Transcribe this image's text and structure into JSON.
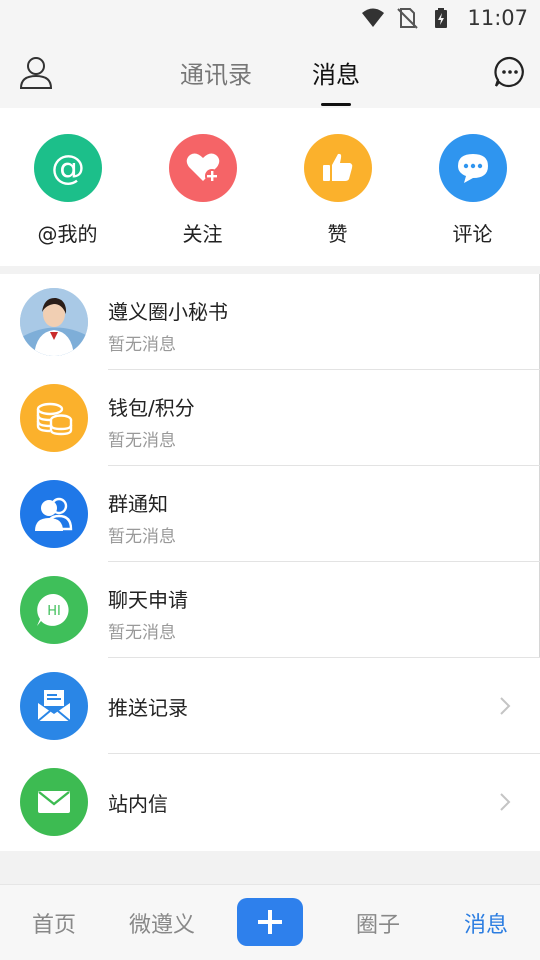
{
  "status_bar": {
    "time": "11:07"
  },
  "header": {
    "tabs": [
      {
        "label": "通讯录",
        "active": false
      },
      {
        "label": "消息",
        "active": true
      }
    ]
  },
  "quick_actions": [
    {
      "label": "@我的",
      "icon": "at-icon",
      "color": "#1cbf8a"
    },
    {
      "label": "关注",
      "icon": "heart-plus-icon",
      "color": "#f56467"
    },
    {
      "label": "赞",
      "icon": "thumbs-up-icon",
      "color": "#fbb12c"
    },
    {
      "label": "评论",
      "icon": "comment-icon",
      "color": "#2f95ef"
    }
  ],
  "messages": [
    {
      "title": "遵义圈小秘书",
      "subtitle": "暂无消息",
      "icon": "assistant-avatar"
    },
    {
      "title": "钱包/积分",
      "subtitle": "暂无消息",
      "icon": "coins-icon",
      "color": "#fbb12c"
    },
    {
      "title": "群通知",
      "subtitle": "暂无消息",
      "icon": "group-icon",
      "color": "#1f78e8"
    },
    {
      "title": "聊天申请",
      "subtitle": "暂无消息",
      "icon": "hi-chat-icon",
      "color": "#3fbf5a"
    },
    {
      "title": "推送记录",
      "icon": "mail-open-icon",
      "color": "#2a86e6"
    },
    {
      "title": "站内信",
      "icon": "envelope-icon",
      "color": "#3dbb52"
    }
  ],
  "bottom_nav": [
    {
      "label": "首页",
      "active": false
    },
    {
      "label": "微遵义",
      "active": false
    },
    {
      "label": "圈子",
      "active": false
    },
    {
      "label": "消息",
      "active": true
    }
  ]
}
